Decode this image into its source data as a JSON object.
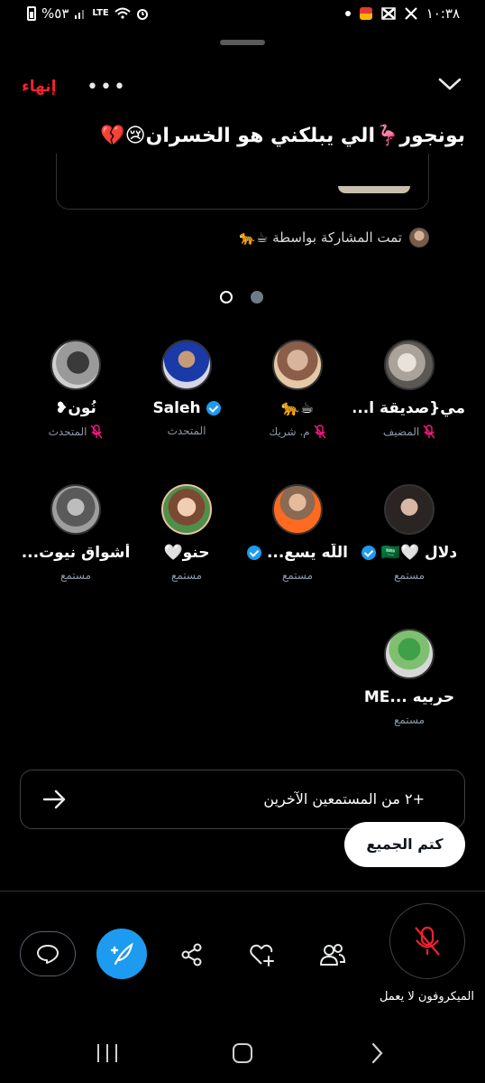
{
  "status_bar": {
    "battery": "%٥٣",
    "time": "١٠:٣٨",
    "network": "LTE"
  },
  "header": {
    "end_label": "إنهاء",
    "more_label": "•••"
  },
  "space": {
    "title": "بونجور🦩الي يبلكني هو الخسران😢💔",
    "shared_by": "تمت المشاركة بواسطة ☕🐆"
  },
  "pagination": {
    "pages": 2,
    "active_page": 1
  },
  "participants": [
    {
      "name": "مي{صديقة ا...",
      "role": "المضيف",
      "muted": true,
      "verified": false
    },
    {
      "name": "☕🐆",
      "role": "م. شريك",
      "muted": true,
      "verified": false
    },
    {
      "name": "Saleh",
      "role": "المتحدث",
      "muted": false,
      "verified": true
    },
    {
      "name": "نُون❥",
      "role": "المتحدث",
      "muted": true,
      "verified": false
    },
    {
      "name": "دلال 🤍🇸🇦",
      "role": "مستمع",
      "muted": false,
      "verified": true
    },
    {
      "name": "اللّه يسع...",
      "role": "مستمع",
      "muted": false,
      "verified": true
    },
    {
      "name": "حنو🤍",
      "role": "مستمع",
      "muted": false,
      "verified": false
    },
    {
      "name": "أشواق نيوت...",
      "role": "مستمع",
      "muted": false,
      "verified": false
    },
    {
      "name": "حربيه ...ME",
      "role": "مستمع",
      "muted": false,
      "verified": false
    }
  ],
  "listeners": {
    "label": "+٢ من المستمعين الآخرين"
  },
  "actions": {
    "mute_all": "كتم الجميع",
    "mic_status": "الميكروفون لا يعمل"
  },
  "colors": {
    "accent": "#1d9bf0",
    "danger": "#f4212e",
    "background": "#000000",
    "muted_text": "#8b98a5"
  },
  "icons": {
    "chat": "chat-bubble-icon",
    "compose": "compose-feather-icon",
    "share": "share-icon",
    "react": "heart-plus-icon",
    "people": "people-icon",
    "mic": "mic-off-icon"
  }
}
